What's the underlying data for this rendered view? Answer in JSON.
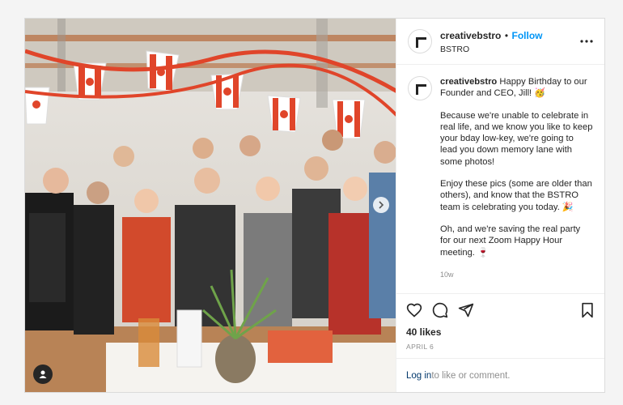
{
  "header": {
    "username": "creativebstro",
    "separator": "•",
    "follow_label": "Follow",
    "location": "BSTRO",
    "more_icon": "more-horizontal-icon"
  },
  "caption": {
    "username": "creativebstro",
    "line1": "Happy Birthday to our Founder and CEO, Jill! 🥳",
    "para2": "Because we're unable to celebrate in real life, and we know you like to keep your bday low-key, we're going to lead you down memory lane with some photos!",
    "para3": "Enjoy these pics (some are older than others), and know that the BSTRO team is celebrating you today. 🎉",
    "para4": "Oh, and we're saving the real party for our next Zoom Happy Hour meeting. 🍷",
    "time_ago": "10w"
  },
  "actions": {
    "like_icon": "heart-icon",
    "comment_icon": "comment-icon",
    "share_icon": "share-icon",
    "save_icon": "bookmark-icon",
    "likes": "40 likes",
    "date": "APRIL 6"
  },
  "login": {
    "link": "Log in",
    "text": " to like or comment."
  },
  "colors": {
    "link_blue": "#0095f6",
    "dark_link": "#00376b",
    "flag_red": "#e0452a"
  }
}
